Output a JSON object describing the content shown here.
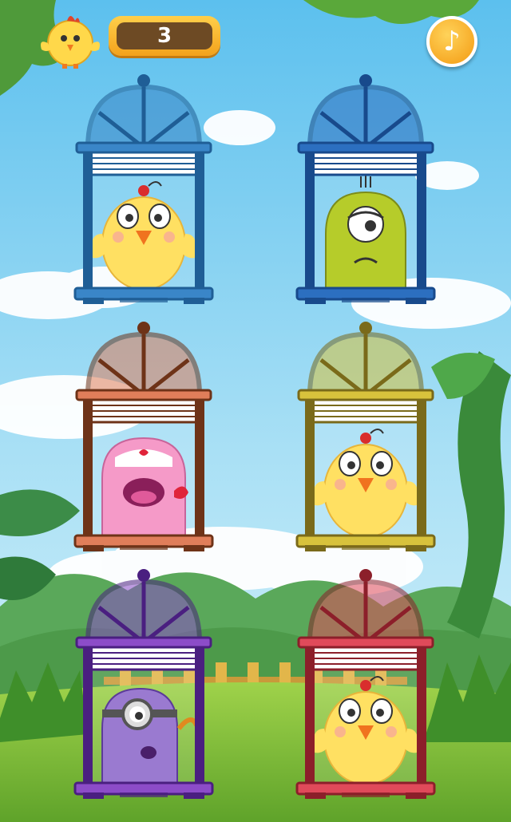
{
  "hud": {
    "score": "3",
    "music_icon": "music-note-icon",
    "music_glyph": "♪"
  },
  "colors": {
    "sky": "#7ec8ec",
    "cloud": "#ffffff",
    "grass": "#7dc142",
    "score_frame": "#f7b52a",
    "score_inner": "#6d4a24"
  },
  "cages": [
    {
      "color": "#3a86c8",
      "dark": "#1f5e96",
      "creature": "chick"
    },
    {
      "color": "#2c6fc0",
      "dark": "#184a8c",
      "creature": "green-one-eyed-monster"
    },
    {
      "color": "#e07e5a",
      "dark": "#6e3318",
      "creature": "pink-monster"
    },
    {
      "color": "#d8c23c",
      "dark": "#7a6a1a",
      "creature": "chick"
    },
    {
      "color": "#8c4cc8",
      "dark": "#4a1f80",
      "creature": "purple-one-eyed-monster"
    },
    {
      "color": "#e04a5a",
      "dark": "#8c1f2a",
      "creature": "chick"
    }
  ]
}
